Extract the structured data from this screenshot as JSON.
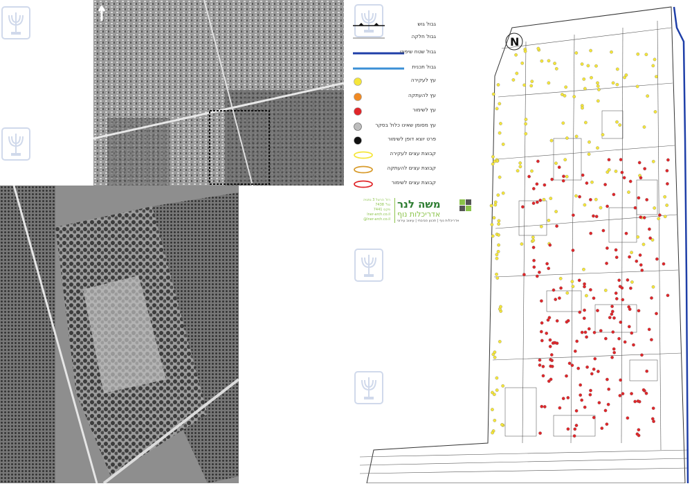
{
  "legend": {
    "items": [
      {
        "label": "גבול גוש",
        "symbol": "block-boundary-line"
      },
      {
        "label": "גבול חלקה",
        "symbol": "parcel-boundary-line"
      },
      {
        "label": "גבול שטח שיפוט",
        "symbol": "jurisdiction-boundary-line",
        "color": "#1f3fa8"
      },
      {
        "label": "גבול תכנית",
        "symbol": "plan-boundary-line",
        "color": "#3b8fd6"
      },
      {
        "label": "עץ לעקירה",
        "symbol": "circle",
        "color": "#f5e63a"
      },
      {
        "label": "עץ להעתקה",
        "symbol": "circle",
        "color": "#f08a24"
      },
      {
        "label": "עץ לשימור",
        "symbol": "circle",
        "color": "#e0262a"
      },
      {
        "label": "עץ מסומן שאינו כלול בסקר",
        "symbol": "circle",
        "color": "#bdbdbd"
      },
      {
        "label": "פרט יוצא דופן לשימור",
        "symbol": "circle",
        "color": "#111111"
      },
      {
        "label": "קבוצת עצים לעקירה",
        "symbol": "loop",
        "color": "#f5e63a"
      },
      {
        "label": "קבוצת עצים להעתקה",
        "symbol": "loop",
        "color": "#d89b2b"
      },
      {
        "label": "קבוצת עצים לשימור",
        "symbol": "loop",
        "color": "#e0262a"
      }
    ]
  },
  "firm": {
    "name": "משה לנר",
    "subtitle": "אדריכלות נוף",
    "tagline": "אדריכלות נוף | תכנון סביבתי | עיצוב עירוני",
    "contact": [
      "רח' הרצל 3 נתניה",
      "טל' 7438",
      "פקס 7441",
      "lner-arch.co.il",
      "@lner-arch.co.il"
    ]
  },
  "map": {
    "north_marker": "N",
    "colors": {
      "tree_remove": "#f5e63a",
      "tree_preserve": "#e0262a",
      "jurisdiction": "#1f3fa8"
    }
  }
}
